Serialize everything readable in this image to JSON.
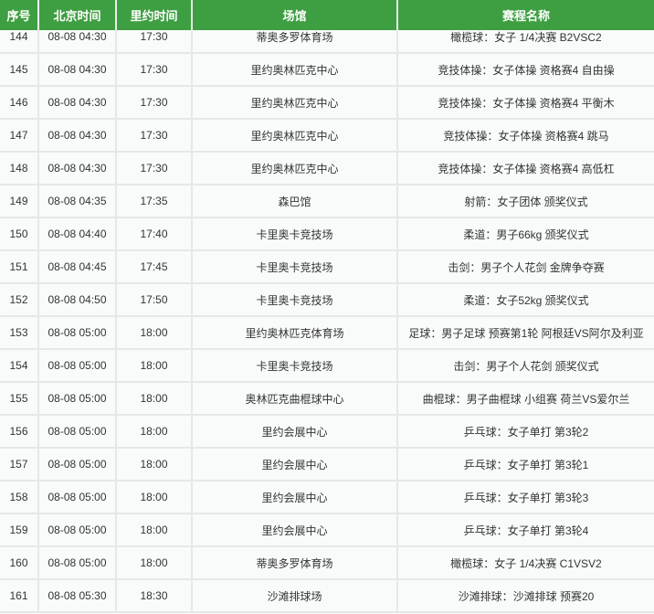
{
  "header": {
    "no": "序号",
    "beijing_time": "北京时间",
    "rio_time": "里约时间",
    "venue": "场馆",
    "event": "赛程名称"
  },
  "rows": [
    {
      "no": "144",
      "beijing": "08-08 04:30",
      "rio": "17:30",
      "venue": "蒂奥多罗体育场",
      "event": "橄榄球：女子 1/4决赛 B2VSC2"
    },
    {
      "no": "145",
      "beijing": "08-08 04:30",
      "rio": "17:30",
      "venue": "里约奥林匹克中心",
      "event": "竞技体操：女子体操 资格赛4 自由操"
    },
    {
      "no": "146",
      "beijing": "08-08 04:30",
      "rio": "17:30",
      "venue": "里约奥林匹克中心",
      "event": "竞技体操：女子体操 资格赛4 平衡木"
    },
    {
      "no": "147",
      "beijing": "08-08 04:30",
      "rio": "17:30",
      "venue": "里约奥林匹克中心",
      "event": "竞技体操：女子体操 资格赛4 跳马"
    },
    {
      "no": "148",
      "beijing": "08-08 04:30",
      "rio": "17:30",
      "venue": "里约奥林匹克中心",
      "event": "竞技体操：女子体操 资格赛4 高低杠"
    },
    {
      "no": "149",
      "beijing": "08-08 04:35",
      "rio": "17:35",
      "venue": "森巴馆",
      "event": "射箭：女子团体 颁奖仪式"
    },
    {
      "no": "150",
      "beijing": "08-08 04:40",
      "rio": "17:40",
      "venue": "卡里奥卡竞技场",
      "event": "柔道：男子66kg 颁奖仪式"
    },
    {
      "no": "151",
      "beijing": "08-08 04:45",
      "rio": "17:45",
      "venue": "卡里奥卡竞技场",
      "event": "击剑：男子个人花剑 金牌争夺赛"
    },
    {
      "no": "152",
      "beijing": "08-08 04:50",
      "rio": "17:50",
      "venue": "卡里奥卡竞技场",
      "event": "柔道：女子52kg 颁奖仪式"
    },
    {
      "no": "153",
      "beijing": "08-08 05:00",
      "rio": "18:00",
      "venue": "里约奥林匹克体育场",
      "event": "足球：男子足球 预赛第1轮 阿根廷VS阿尔及利亚"
    },
    {
      "no": "154",
      "beijing": "08-08 05:00",
      "rio": "18:00",
      "venue": "卡里奥卡竞技场",
      "event": "击剑：男子个人花剑 颁奖仪式"
    },
    {
      "no": "155",
      "beijing": "08-08 05:00",
      "rio": "18:00",
      "venue": "奥林匹克曲棍球中心",
      "event": "曲棍球：男子曲棍球 小组赛 荷兰VS爱尔兰"
    },
    {
      "no": "156",
      "beijing": "08-08 05:00",
      "rio": "18:00",
      "venue": "里约会展中心",
      "event": "乒乓球：女子单打 第3轮2"
    },
    {
      "no": "157",
      "beijing": "08-08 05:00",
      "rio": "18:00",
      "venue": "里约会展中心",
      "event": "乒乓球：女子单打 第3轮1"
    },
    {
      "no": "158",
      "beijing": "08-08 05:00",
      "rio": "18:00",
      "venue": "里约会展中心",
      "event": "乒乓球：女子单打 第3轮3"
    },
    {
      "no": "159",
      "beijing": "08-08 05:00",
      "rio": "18:00",
      "venue": "里约会展中心",
      "event": "乒乓球：女子单打 第3轮4"
    },
    {
      "no": "160",
      "beijing": "08-08 05:00",
      "rio": "18:00",
      "venue": "蒂奥多罗体育场",
      "event": "橄榄球：女子 1/4决赛 C1VSV2"
    },
    {
      "no": "161",
      "beijing": "08-08 05:30",
      "rio": "18:30",
      "venue": "沙滩排球场",
      "event": "沙滩排球：沙滩排球 预赛20"
    }
  ],
  "colors": {
    "header_bg": "#3e9f42",
    "highlight": "#3a7fc6"
  }
}
